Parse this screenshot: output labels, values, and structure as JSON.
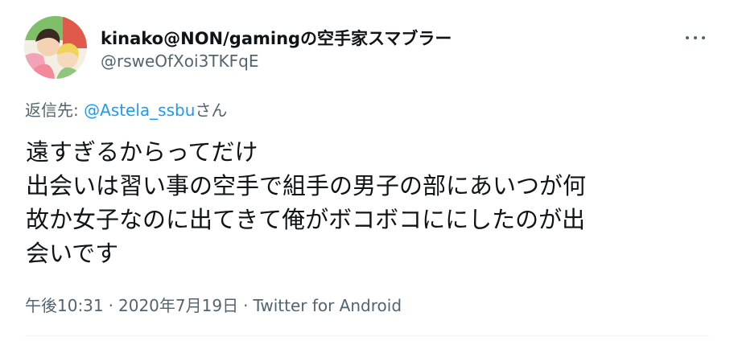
{
  "tweet": {
    "author": {
      "display_name": "kinako@NON/gamingの空手家スマブラー",
      "handle": "@rsweOfXoi3TKFqE",
      "avatar_icon": "avatar-illustration"
    },
    "more_icon": "more-horizontal-icon",
    "reply": {
      "prefix": "返信先: ",
      "mention": "@Astela_ssbu",
      "suffix": "さん"
    },
    "text_lines": [
      "遠すぎるからってだけ",
      "出会いは習い事の空手で組手の男子の部にあいつが何",
      "故か女子なのに出てきて俺がボコボコににしたのが出",
      "会いです"
    ],
    "meta": {
      "time": "午後10:31",
      "separator1": "·",
      "date": "2020年7月19日",
      "separator2": "·",
      "source": "Twitter for Android"
    }
  },
  "colors": {
    "text": "#0f1419",
    "secondary": "#536471",
    "link": "#1d9bf0",
    "divider": "#eff3f4"
  }
}
